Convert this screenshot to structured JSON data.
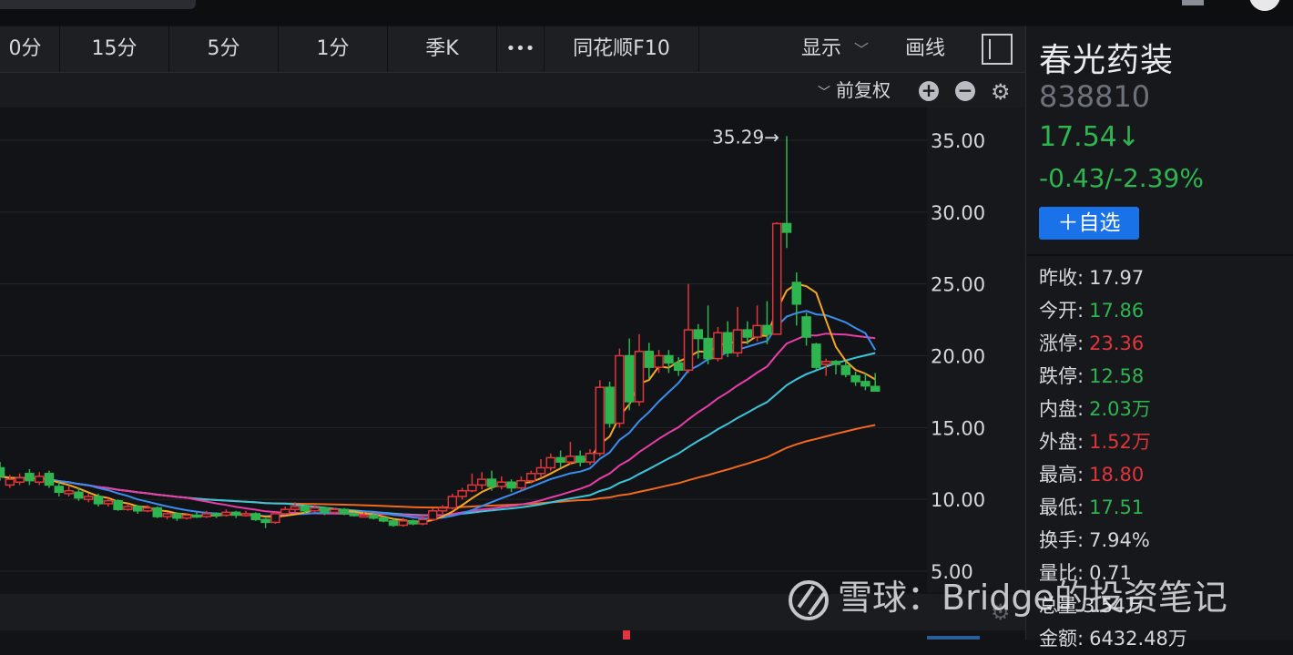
{
  "toolbar": {
    "periods": [
      "0分",
      "15分",
      "5分",
      "1分",
      "季K",
      "•••",
      "同花顺F10"
    ],
    "show_label": "显示",
    "draw_label": "画线",
    "adjust_label": "前复权"
  },
  "stock": {
    "name": "春光药装",
    "code": "838810",
    "price": "17.54↓",
    "change": "-0.43/-2.39%",
    "add_watchlist": "＋自选"
  },
  "quote_rows": [
    {
      "label": "昨收:",
      "value": "17.97",
      "color": "white"
    },
    {
      "label": "今开:",
      "value": "17.86",
      "color": "green"
    },
    {
      "label": "涨停:",
      "value": "23.36",
      "color": "red"
    },
    {
      "label": "跌停:",
      "value": "12.58",
      "color": "green"
    },
    {
      "label": "内盘:",
      "value": "2.03万",
      "color": "green"
    },
    {
      "label": "外盘:",
      "value": "1.52万",
      "color": "red"
    },
    {
      "label": "最高:",
      "value": "18.80",
      "color": "red"
    },
    {
      "label": "最低:",
      "value": "17.51",
      "color": "green"
    },
    {
      "label": "换手:",
      "value": "7.94%",
      "color": "white"
    },
    {
      "label": "量比:",
      "value": "0.71",
      "color": "white"
    },
    {
      "label": "总量",
      "value": "3.54万",
      "color": "white"
    },
    {
      "label": "金额:",
      "value": "6432.48万",
      "color": "white"
    }
  ],
  "watermark": "雪球：Bridge的投资笔记",
  "colors": {
    "up": "#e0363b",
    "down": "#2fb550",
    "ma5": "#f5a623",
    "ma10": "#3a8ef0",
    "ma20": "#e83ea8",
    "ma30": "#3cc6dc",
    "ma60": "#f0691e"
  },
  "chart_data": {
    "type": "candlestick",
    "y_ticks": [
      "35.00",
      "30.00",
      "25.00",
      "20.00",
      "15.00",
      "10.00",
      "5.00"
    ],
    "ylim": [
      5,
      35
    ],
    "high_label": "35.29→",
    "candles": [
      [
        12.2,
        11.6,
        12.6,
        11.3
      ],
      [
        11.0,
        11.4,
        11.7,
        10.8
      ],
      [
        11.2,
        11.5,
        11.8,
        11.0
      ],
      [
        11.8,
        11.3,
        12.1,
        11.0
      ],
      [
        11.2,
        11.6,
        11.9,
        11.0
      ],
      [
        11.8,
        11.0,
        12.0,
        10.8
      ],
      [
        10.9,
        10.5,
        11.2,
        10.2
      ],
      [
        10.4,
        10.6,
        10.9,
        10.2
      ],
      [
        10.5,
        10.1,
        10.8,
        9.9
      ],
      [
        10.0,
        10.2,
        10.4,
        9.8
      ],
      [
        10.2,
        9.7,
        10.4,
        9.5
      ],
      [
        9.7,
        9.9,
        10.1,
        9.5
      ],
      [
        9.9,
        9.3,
        10.0,
        9.2
      ],
      [
        9.3,
        9.5,
        9.7,
        9.2
      ],
      [
        9.5,
        9.2,
        9.6,
        9.0
      ],
      [
        9.2,
        9.4,
        9.6,
        9.1
      ],
      [
        9.4,
        8.8,
        9.5,
        8.7
      ],
      [
        8.8,
        9.0,
        9.1,
        8.6
      ],
      [
        9.0,
        8.7,
        9.1,
        8.5
      ],
      [
        8.7,
        8.9,
        9.0,
        8.6
      ],
      [
        8.9,
        8.8,
        9.1,
        8.7
      ],
      [
        8.8,
        9.0,
        9.2,
        8.7
      ],
      [
        9.0,
        8.9,
        9.1,
        8.7
      ],
      [
        8.9,
        9.1,
        9.3,
        8.8
      ],
      [
        9.1,
        8.9,
        9.2,
        8.7
      ],
      [
        8.9,
        9.0,
        9.2,
        8.8
      ],
      [
        9.0,
        8.6,
        9.1,
        8.5
      ],
      [
        8.6,
        8.4,
        8.7,
        8.0
      ],
      [
        8.4,
        9.0,
        9.1,
        8.3
      ],
      [
        9.0,
        9.3,
        9.5,
        8.9
      ],
      [
        9.3,
        9.5,
        9.8,
        9.1
      ],
      [
        9.5,
        9.2,
        9.6,
        9.0
      ],
      [
        9.2,
        9.4,
        9.6,
        9.1
      ],
      [
        9.4,
        9.1,
        9.5,
        8.9
      ],
      [
        9.1,
        9.3,
        9.4,
        9.0
      ],
      [
        9.3,
        9.0,
        9.4,
        8.9
      ],
      [
        9.0,
        8.9,
        9.1,
        8.8
      ],
      [
        8.9,
        8.9,
        9.1,
        8.8
      ],
      [
        8.9,
        8.7,
        9.0,
        8.6
      ],
      [
        8.7,
        8.5,
        8.8,
        8.4
      ],
      [
        8.5,
        8.2,
        8.6,
        8.1
      ],
      [
        8.2,
        8.5,
        8.7,
        8.1
      ],
      [
        8.5,
        8.3,
        8.6,
        8.2
      ],
      [
        8.3,
        8.6,
        8.9,
        8.2
      ],
      [
        8.6,
        9.2,
        9.4,
        8.5
      ],
      [
        9.2,
        9.4,
        9.6,
        9.0
      ],
      [
        9.4,
        10.2,
        10.4,
        9.3
      ],
      [
        10.2,
        10.6,
        10.8,
        10.0
      ],
      [
        10.6,
        11.0,
        11.8,
        10.5
      ],
      [
        11.0,
        11.4,
        11.9,
        10.7
      ],
      [
        11.4,
        10.9,
        12.0,
        10.6
      ],
      [
        10.9,
        11.2,
        11.6,
        10.7
      ],
      [
        11.2,
        10.8,
        11.4,
        10.5
      ],
      [
        10.8,
        11.3,
        11.6,
        10.6
      ],
      [
        11.3,
        11.8,
        12.0,
        11.1
      ],
      [
        11.8,
        12.2,
        12.8,
        11.5
      ],
      [
        12.2,
        12.9,
        13.2,
        12.0
      ],
      [
        12.9,
        12.6,
        13.4,
        12.2
      ],
      [
        12.6,
        13.0,
        14.0,
        12.4
      ],
      [
        13.0,
        12.6,
        13.4,
        12.3
      ],
      [
        12.6,
        13.2,
        13.5,
        12.4
      ],
      [
        13.2,
        17.8,
        18.3,
        13.0
      ],
      [
        17.8,
        15.3,
        18.2,
        15.0
      ],
      [
        15.3,
        20.0,
        20.5,
        15.0
      ],
      [
        20.0,
        16.8,
        21.2,
        16.2
      ],
      [
        16.8,
        20.3,
        21.5,
        16.5
      ],
      [
        20.3,
        19.2,
        20.9,
        18.4
      ],
      [
        19.2,
        20.0,
        20.4,
        18.8
      ],
      [
        20.0,
        19.5,
        20.4,
        18.8
      ],
      [
        19.5,
        19.0,
        19.9,
        18.6
      ],
      [
        19.0,
        21.8,
        25.0,
        18.8
      ],
      [
        21.8,
        21.2,
        22.2,
        19.8
      ],
      [
        21.2,
        19.8,
        23.5,
        19.4
      ],
      [
        19.8,
        21.6,
        22.0,
        19.6
      ],
      [
        21.6,
        20.2,
        22.4,
        19.9
      ],
      [
        20.2,
        21.8,
        23.4,
        19.9
      ],
      [
        21.8,
        21.3,
        22.4,
        20.8
      ],
      [
        21.3,
        22.1,
        23.5,
        21.0
      ],
      [
        22.1,
        21.5,
        23.8,
        20.8
      ],
      [
        21.5,
        29.2,
        29.3,
        21.5
      ],
      [
        29.2,
        28.6,
        35.29,
        27.5
      ],
      [
        25.1,
        23.6,
        25.8,
        22.1
      ],
      [
        22.7,
        21.3,
        23.0,
        20.7
      ],
      [
        20.8,
        19.2,
        20.9,
        19.0
      ],
      [
        19.4,
        19.6,
        19.8,
        18.6
      ],
      [
        19.6,
        19.4,
        19.7,
        18.7
      ],
      [
        19.3,
        18.7,
        19.6,
        18.5
      ],
      [
        18.6,
        18.2,
        18.9,
        17.9
      ],
      [
        18.2,
        17.9,
        18.8,
        17.6
      ],
      [
        17.86,
        17.54,
        18.8,
        17.51
      ]
    ]
  }
}
